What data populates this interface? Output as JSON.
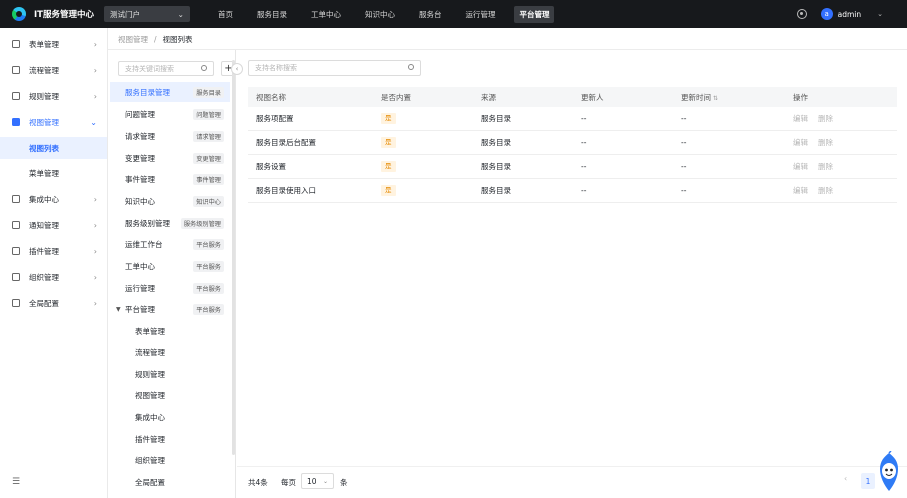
{
  "header": {
    "app_title": "IT服务管理中心",
    "portal_select": "测试门户",
    "nav": [
      "首页",
      "服务目录",
      "工单中心",
      "知识中心",
      "服务台",
      "运行管理",
      "平台管理"
    ],
    "active_nav": "平台管理",
    "user": {
      "avatar_letter": "a",
      "name": "admin"
    }
  },
  "sidebar": {
    "items": [
      {
        "label": "表单管理",
        "icon": "form-icon"
      },
      {
        "label": "流程管理",
        "icon": "flow-icon"
      },
      {
        "label": "规则管理",
        "icon": "rule-icon"
      },
      {
        "label": "视图管理",
        "icon": "view-icon",
        "expanded": true
      },
      {
        "label": "集成中心",
        "icon": "integration-icon"
      },
      {
        "label": "通知管理",
        "icon": "bell-icon"
      },
      {
        "label": "插件管理",
        "icon": "plugin-icon"
      },
      {
        "label": "组织管理",
        "icon": "org-icon"
      },
      {
        "label": "全局配置",
        "icon": "settings-icon"
      }
    ],
    "sub_items": [
      {
        "label": "视图列表",
        "active": true
      },
      {
        "label": "菜单管理",
        "active": false
      }
    ]
  },
  "breadcrumb": {
    "parent": "视图管理",
    "separator": "/",
    "current": "视图列表"
  },
  "tree": {
    "search_placeholder": "支持关键词搜索",
    "add_label": "+",
    "nodes": [
      {
        "name": "服务目录管理",
        "tag": "服务目录",
        "active": true
      },
      {
        "name": "问题管理",
        "tag": "问题管理"
      },
      {
        "name": "请求管理",
        "tag": "请求管理"
      },
      {
        "name": "变更管理",
        "tag": "变更管理"
      },
      {
        "name": "事件管理",
        "tag": "事件管理"
      },
      {
        "name": "知识中心",
        "tag": "知识中心"
      },
      {
        "name": "服务级别管理",
        "tag": "服务级别管理"
      },
      {
        "name": "运维工作台",
        "tag": "平台服务"
      },
      {
        "name": "工单中心",
        "tag": "平台服务"
      },
      {
        "name": "运行管理",
        "tag": "平台服务"
      },
      {
        "name": "平台管理",
        "tag": "平台服务",
        "expanded": true
      }
    ],
    "children": [
      "表单管理",
      "流程管理",
      "规则管理",
      "视图管理",
      "集成中心",
      "插件管理",
      "组织管理",
      "全局配置"
    ]
  },
  "main": {
    "search_placeholder": "支持名称搜索",
    "columns": [
      "视图名称",
      "是否内置",
      "来源",
      "更新人",
      "更新时间",
      "操作"
    ],
    "rows": [
      {
        "name": "服务项配置",
        "builtin": "是",
        "source": "服务目录",
        "updater": "--",
        "updated": "--",
        "edit": "编辑",
        "delete": "删除"
      },
      {
        "name": "服务目录后台配置",
        "builtin": "是",
        "source": "服务目录",
        "updater": "--",
        "updated": "--",
        "edit": "编辑",
        "delete": "删除"
      },
      {
        "name": "服务设置",
        "builtin": "是",
        "source": "服务目录",
        "updater": "--",
        "updated": "--",
        "edit": "编辑",
        "delete": "删除"
      },
      {
        "name": "服务目录使用入口",
        "builtin": "是",
        "source": "服务目录",
        "updater": "--",
        "updated": "--",
        "edit": "编辑",
        "delete": "删除"
      }
    ]
  },
  "pagination": {
    "total_text": "共4条",
    "per_page_label": "每页",
    "page_size": "10",
    "per_page_unit": "条",
    "current_page": "1",
    "prev": "‹"
  },
  "colors": {
    "accent": "#3370ff",
    "topbar": "#17191c",
    "badge_bg": "#fff3e0",
    "badge_text": "#e68a00"
  }
}
